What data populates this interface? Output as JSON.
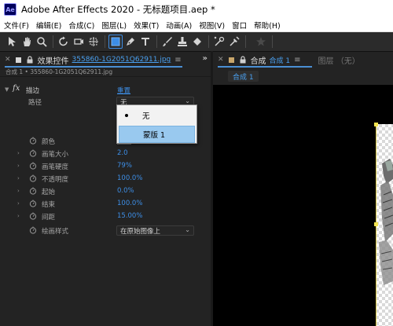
{
  "app": {
    "logo_text": "Ae",
    "window_title": "Adobe After Effects 2020 - 无标题项目.aep *"
  },
  "menu": [
    "文件(F)",
    "编辑(E)",
    "合成(C)",
    "图层(L)",
    "效果(T)",
    "动画(A)",
    "视图(V)",
    "窗口",
    "帮助(H)"
  ],
  "toolbar": {
    "tools": [
      "selection-tool",
      "hand-tool",
      "zoom-tool",
      "rotate-tool",
      "camera-orbit-tool",
      "pan-behind-tool",
      "rectangle-tool",
      "pen-tool",
      "type-tool",
      "brush-tool",
      "clone-stamp-tool",
      "eraser-tool",
      "roto-brush-tool",
      "puppet-pin-tool",
      "star-tool"
    ],
    "active_tool": "rectangle-tool",
    "accent_color": "#3d8ee6"
  },
  "effect_controls": {
    "tab_title": "效果控件",
    "tab_file": "355860-1G2051Q62911.jpg",
    "breadcrumb": "合成 1 • 355860-1G2051Q62911.jpg",
    "effect_name": "描边",
    "reset_label": "重置",
    "path_label": "路径",
    "path_value": "无",
    "properties": [
      {
        "label": "颜色",
        "value": ""
      },
      {
        "label": "画笔大小",
        "value": "2.0"
      },
      {
        "label": "画笔硬度",
        "value": "79%"
      },
      {
        "label": "不透明度",
        "value": "100.0%"
      },
      {
        "label": "起始",
        "value": "0.0%"
      },
      {
        "label": "结束",
        "value": "100.0%"
      },
      {
        "label": "间距",
        "value": "15.00%"
      }
    ],
    "paint_style_label": "绘画样式",
    "paint_style_value": "在原始图像上",
    "color_swatch": "#ffffff",
    "dropdown_options": [
      "无",
      "蒙版 1"
    ],
    "dropdown_selected": "无",
    "dropdown_hover": "蒙版 1"
  },
  "composition": {
    "tab_title": "合成",
    "tab_name": "合成 1",
    "layer_tab": "图层 （无）",
    "subtab": "合成 1"
  }
}
